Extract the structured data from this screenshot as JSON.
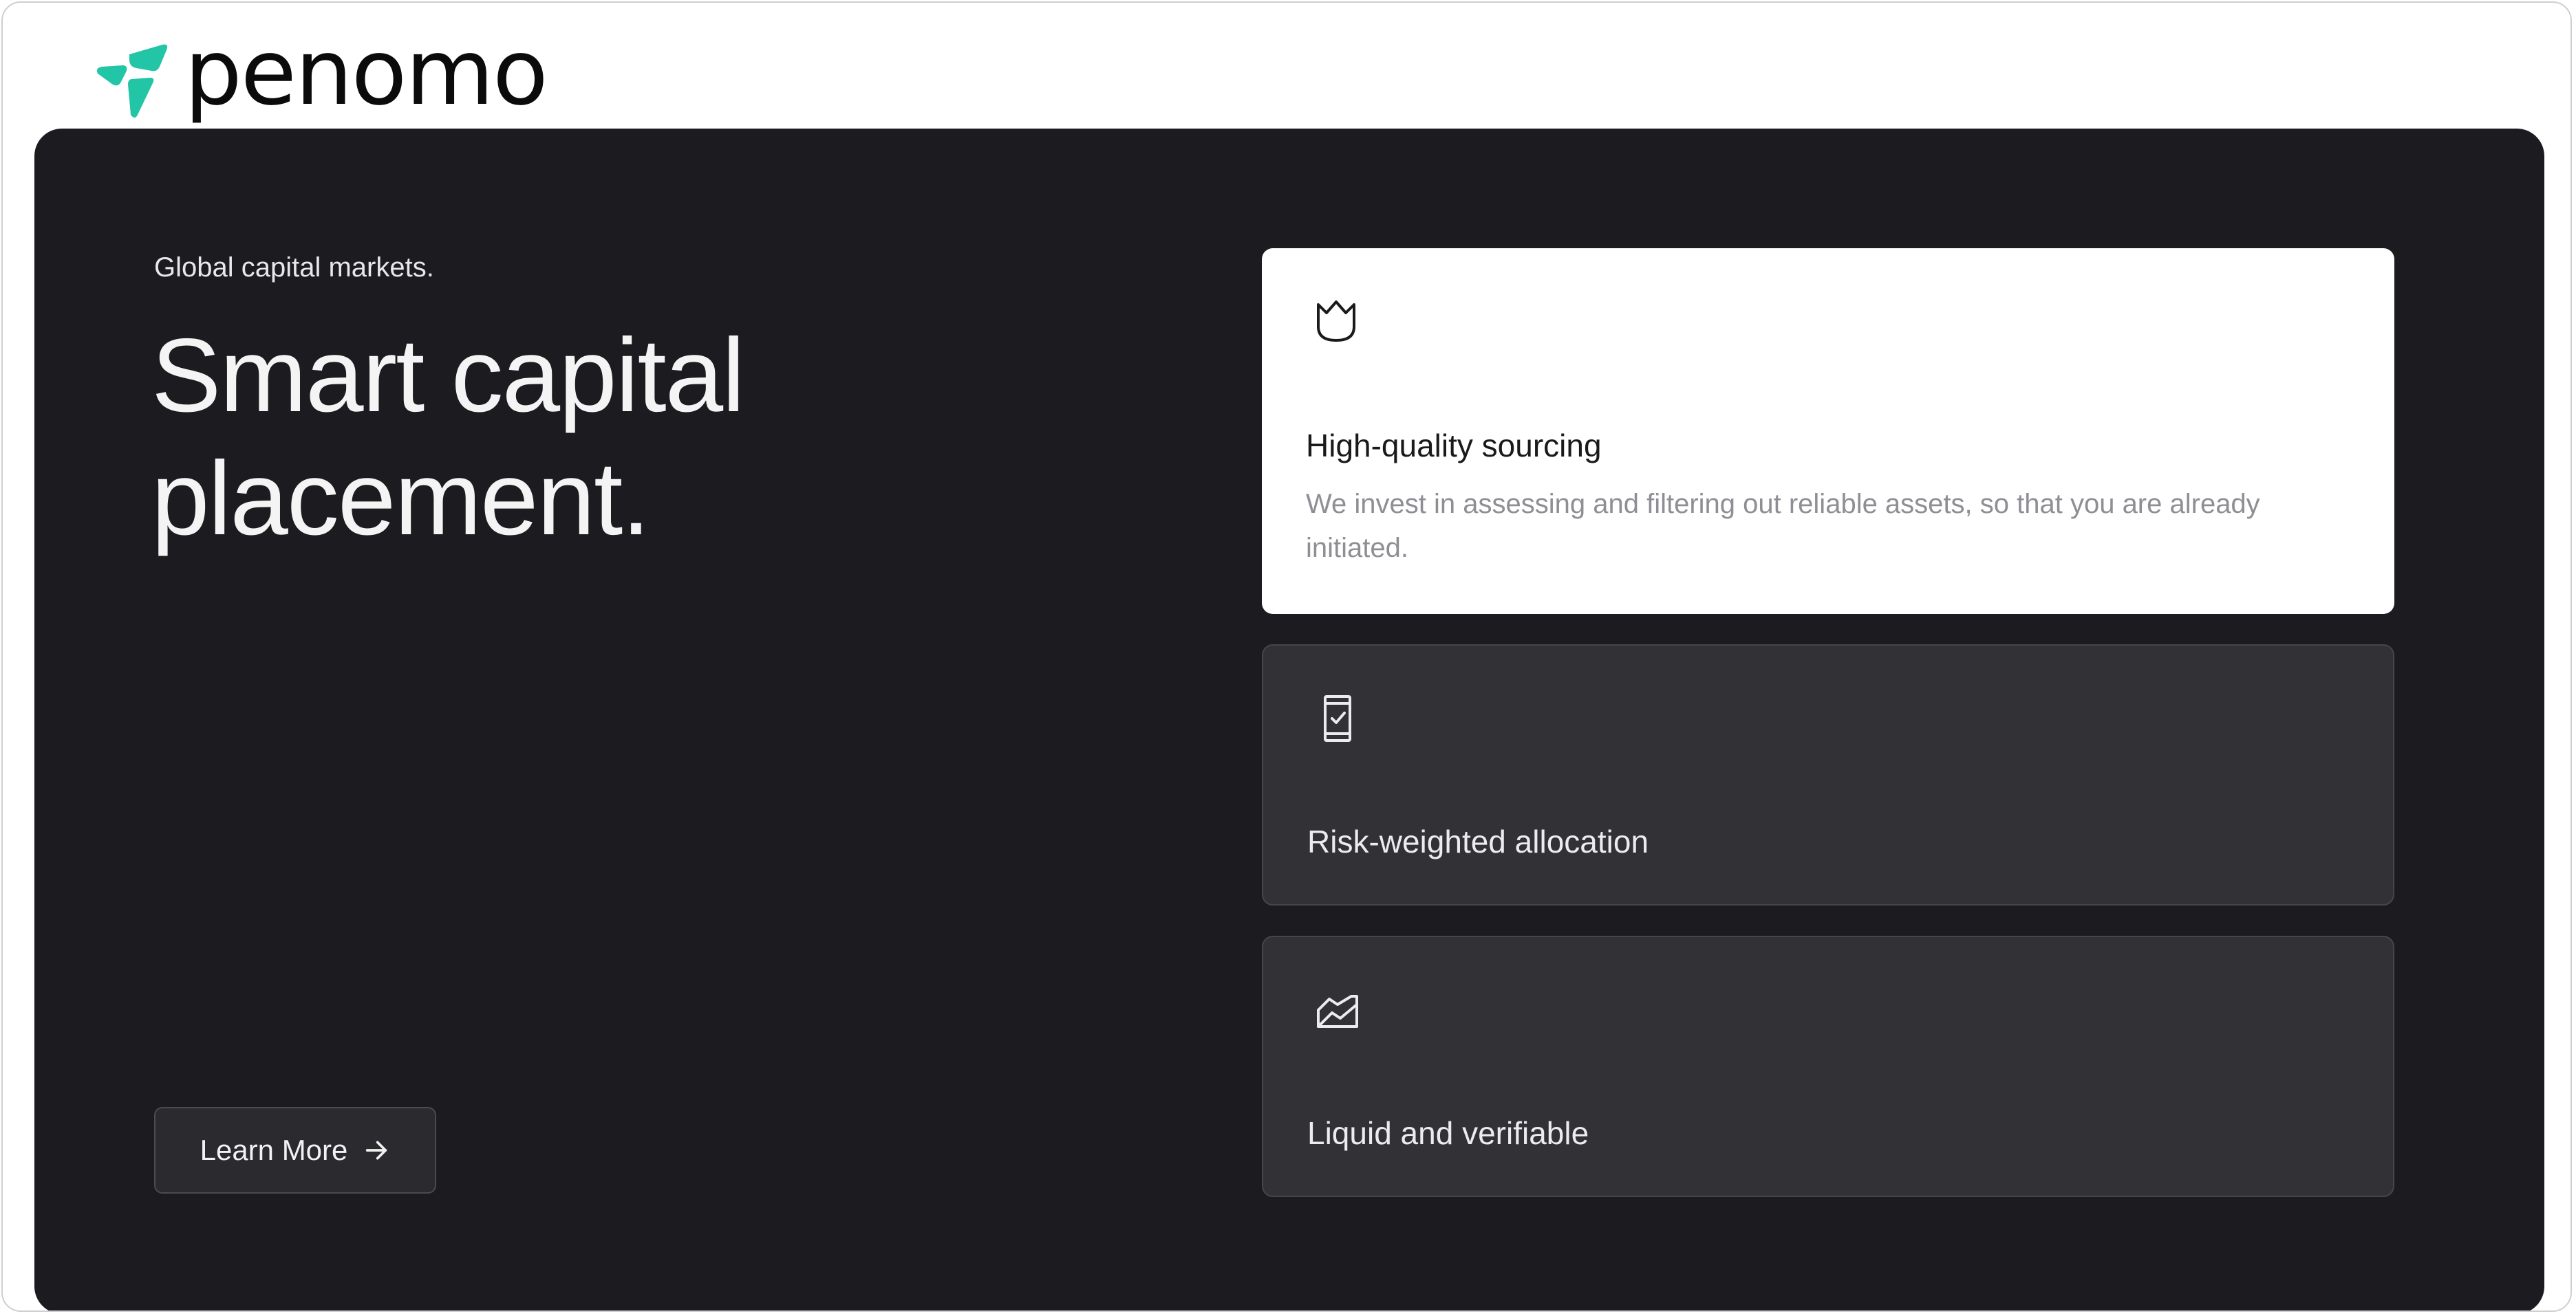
{
  "brand": {
    "name": "penomo",
    "accent_color": "#22c5a6"
  },
  "hero": {
    "eyebrow": "Global capital markets.",
    "headline": "Smart capital placement.",
    "cta": {
      "label": "Learn More",
      "icon": "arrow-right-icon"
    },
    "background_color": "#1c1c20"
  },
  "features": [
    {
      "icon": "crown-icon",
      "title": "High-quality sourcing",
      "description": "We invest in assessing and filtering out reliable assets, so that you are already initiated.",
      "active": true
    },
    {
      "icon": "phone-check-icon",
      "title": "Risk-weighted allocation",
      "active": false
    },
    {
      "icon": "chart-trend-icon",
      "title": "Liquid and verifiable",
      "active": false
    }
  ]
}
